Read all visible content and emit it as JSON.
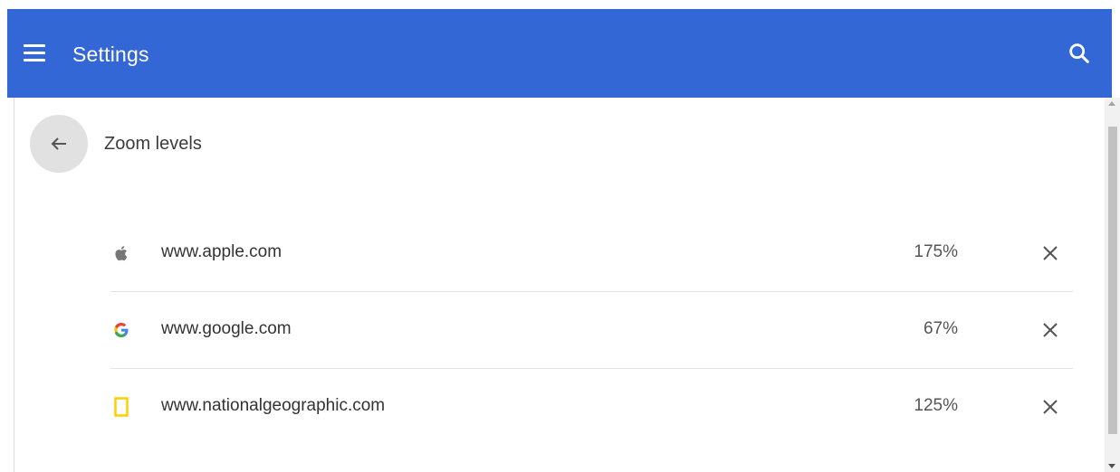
{
  "header": {
    "title": "Settings",
    "menu_icon": "hamburger-menu-icon",
    "search_icon": "search-icon",
    "background_color": "#3367d6"
  },
  "subpage": {
    "title": "Zoom levels",
    "back_icon": "arrow-back-icon"
  },
  "zoom_levels": [
    {
      "site": "www.apple.com",
      "zoom": "175%",
      "favicon": "apple-logo-icon",
      "remove_icon": "close-icon"
    },
    {
      "site": "www.google.com",
      "zoom": "67%",
      "favicon": "google-logo-icon",
      "remove_icon": "close-icon"
    },
    {
      "site": "www.nationalgeographic.com",
      "zoom": "125%",
      "favicon": "national-geographic-logo-icon",
      "remove_icon": "close-icon"
    }
  ]
}
